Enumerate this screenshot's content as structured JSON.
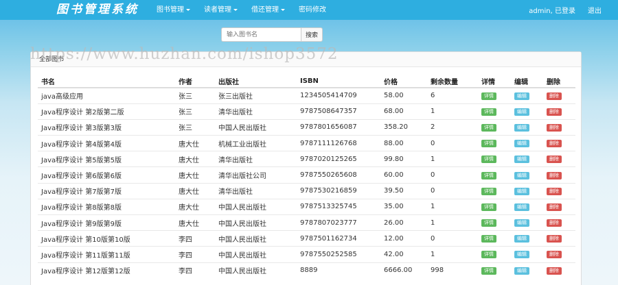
{
  "navbar": {
    "brand": "图书管理系统",
    "menu": [
      {
        "label": "图书管理",
        "dropdown": true
      },
      {
        "label": "读者管理",
        "dropdown": true
      },
      {
        "label": "借还管理",
        "dropdown": true
      },
      {
        "label": "密码修改",
        "dropdown": false
      }
    ],
    "user_text": "admin, 已登录",
    "logout_label": "退出"
  },
  "search": {
    "placeholder": "输入图书名",
    "button_label": "搜索"
  },
  "watermark": "https://www.huzhan.com/ishop3572",
  "panel": {
    "title": "全部图书"
  },
  "table": {
    "columns": [
      "书名",
      "作者",
      "出版社",
      "ISBN",
      "价格",
      "剩余数量",
      "详情",
      "编辑",
      "删除"
    ],
    "action_labels": {
      "detail": "详情",
      "edit": "编辑",
      "delete": "删除"
    },
    "rows": [
      {
        "title": "java高级应用",
        "author": "张三",
        "publisher": "张三出版社",
        "isbn": "1234505414709",
        "price": "58.00",
        "stock": "6"
      },
      {
        "title": "Java程序设计 第2版第二版",
        "author": "张三",
        "publisher": "清华出版社",
        "isbn": "9787508647357",
        "price": "68.00",
        "stock": "1"
      },
      {
        "title": "Java程序设计 第3版第3版",
        "author": "张三",
        "publisher": "中国人民出版社",
        "isbn": "9787801656087",
        "price": "358.20",
        "stock": "2"
      },
      {
        "title": "Java程序设计 第4版第4版",
        "author": "唐大仕",
        "publisher": "机械工业出版社",
        "isbn": "9787111126768",
        "price": "88.00",
        "stock": "0"
      },
      {
        "title": "Java程序设计 第5版第5版",
        "author": "唐大仕",
        "publisher": "清华出版社",
        "isbn": "9787020125265",
        "price": "99.80",
        "stock": "1"
      },
      {
        "title": "Java程序设计 第6版第6版",
        "author": "唐大仕",
        "publisher": "清华出版社公司",
        "isbn": "9787550265608",
        "price": "60.00",
        "stock": "0"
      },
      {
        "title": "Java程序设计 第7版第7版",
        "author": "唐大仕",
        "publisher": "清华出版社",
        "isbn": "9787530216859",
        "price": "39.50",
        "stock": "0"
      },
      {
        "title": "Java程序设计 第8版第8版",
        "author": "唐大仕",
        "publisher": "中国人民出版社",
        "isbn": "9787513325745",
        "price": "35.00",
        "stock": "1"
      },
      {
        "title": "Java程序设计 第9版第9版",
        "author": "唐大仕",
        "publisher": "中国人民出版社",
        "isbn": "9787807023777",
        "price": "26.00",
        "stock": "1"
      },
      {
        "title": "Java程序设计 第10版第10版",
        "author": "李四",
        "publisher": "中国人民出版社",
        "isbn": "9787501162734",
        "price": "12.00",
        "stock": "0"
      },
      {
        "title": "Java程序设计 第11版第11版",
        "author": "李四",
        "publisher": "中国人民出版社",
        "isbn": "9787550252585",
        "price": "42.00",
        "stock": "1"
      },
      {
        "title": "Java程序设计 第12版第12版",
        "author": "李四",
        "publisher": "中国人民出版社",
        "isbn": "8889",
        "price": "6666.00",
        "stock": "998"
      }
    ]
  }
}
